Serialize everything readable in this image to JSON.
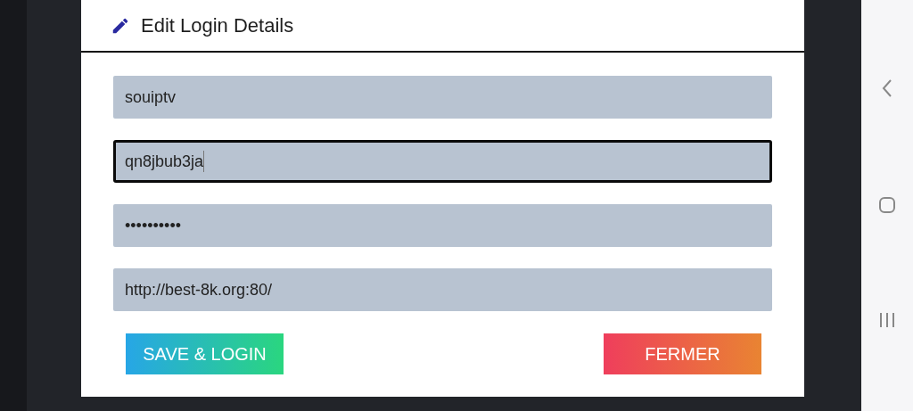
{
  "dialog": {
    "title": "Edit Login Details",
    "fields": [
      {
        "value": "souiptv",
        "focused": false
      },
      {
        "value": "qn8jbub3ja",
        "focused": true
      },
      {
        "value": "••••••••••",
        "focused": false
      },
      {
        "value": "http://best-8k.org:80/",
        "focused": false
      }
    ],
    "buttons": [
      {
        "label": "SAVE & LOGIN",
        "kind": "primary"
      },
      {
        "label": "FERMER",
        "kind": "secondary"
      }
    ]
  }
}
